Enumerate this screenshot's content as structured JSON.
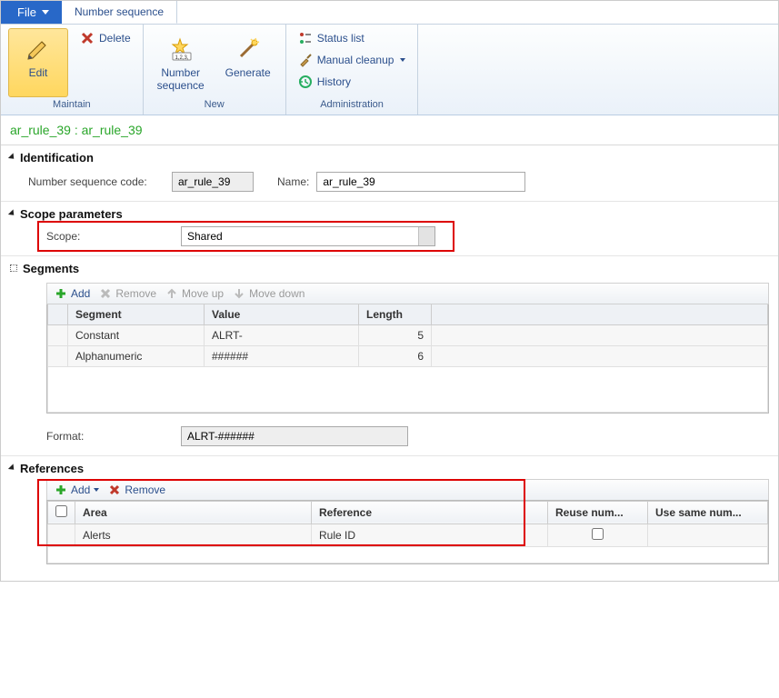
{
  "tabs": {
    "file": "File",
    "active": "Number sequence"
  },
  "ribbon": {
    "maintain": {
      "label": "Maintain",
      "edit": "Edit",
      "delete": "Delete"
    },
    "new_group": {
      "label": "New",
      "number_sequence": "Number\nsequence",
      "generate": "Generate"
    },
    "admin": {
      "label": "Administration",
      "status_list": "Status list",
      "manual_cleanup": "Manual cleanup",
      "history": "History"
    }
  },
  "record_title": "ar_rule_39 : ar_rule_39",
  "identification": {
    "heading": "Identification",
    "code_label": "Number sequence code:",
    "code_value": "ar_rule_39",
    "name_label": "Name:",
    "name_value": "ar_rule_39"
  },
  "scope": {
    "heading": "Scope parameters",
    "label": "Scope:",
    "value": "Shared"
  },
  "segments": {
    "heading": "Segments",
    "toolbar": {
      "add": "Add",
      "remove": "Remove",
      "move_up": "Move up",
      "move_down": "Move down"
    },
    "columns": [
      "Segment",
      "Value",
      "Length"
    ],
    "rows": [
      {
        "segment": "Constant",
        "value": "ALRT-",
        "length": 5
      },
      {
        "segment": "Alphanumeric",
        "value": "######",
        "length": 6
      }
    ],
    "format_label": "Format:",
    "format_value": "ALRT-######"
  },
  "references": {
    "heading": "References",
    "toolbar": {
      "add": "Add",
      "remove": "Remove"
    },
    "columns": [
      "Area",
      "Reference",
      "Reuse num...",
      "Use same num..."
    ],
    "rows": [
      {
        "area": "Alerts",
        "reference": "Rule ID",
        "reuse": false
      }
    ]
  }
}
